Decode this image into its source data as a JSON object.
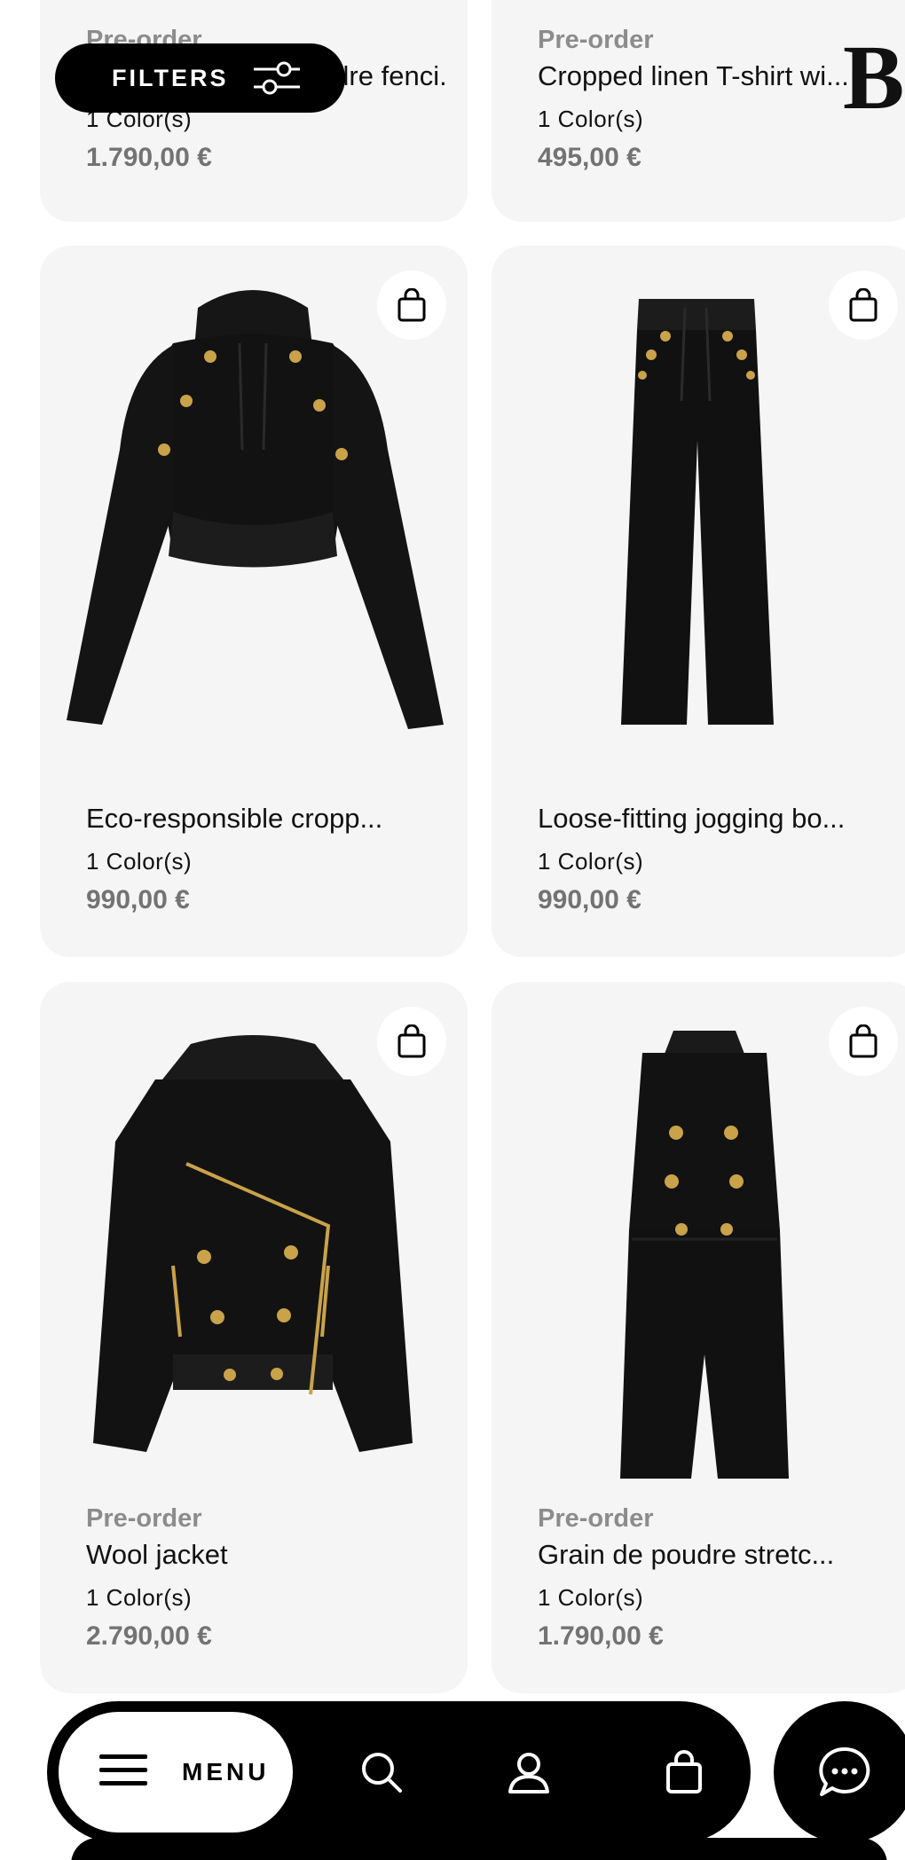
{
  "filters": {
    "label": "FILTERS"
  },
  "brand": {
    "logo_letter": "B"
  },
  "products": [
    {
      "badge": "Pre-order",
      "name": "Stretch grain de poudre fenci...",
      "colors": "1 Color(s)",
      "price": "1.790,00 €"
    },
    {
      "badge": "Pre-order",
      "name": "Cropped linen T-shirt wi...",
      "colors": "1 Color(s)",
      "price": "495,00 €"
    },
    {
      "badge": "",
      "name": "Eco-responsible cropp...",
      "colors": "1 Color(s)",
      "price": "990,00 €",
      "image": "black cropped hoodie with gold buttons"
    },
    {
      "badge": "",
      "name": "Loose-fitting jogging bo...",
      "colors": "1 Color(s)",
      "price": "990,00 €",
      "image": "black jogging pants"
    },
    {
      "badge": "Pre-order",
      "name": "Wool jacket",
      "colors": "1 Color(s)",
      "price": "2.790,00 €",
      "image": "black wool biker jacket"
    },
    {
      "badge": "Pre-order",
      "name": "Grain de poudre stretc...",
      "colors": "1 Color(s)",
      "price": "1.790,00 €",
      "image": "black sleeveless playsuit"
    }
  ],
  "nav": {
    "menu_label": "MENU",
    "icons": [
      "menu-icon",
      "search-icon",
      "account-icon",
      "bag-icon",
      "chat-icon"
    ]
  },
  "colors": {
    "card_bg": "#f5f5f5",
    "price": "#737373",
    "badge": "#8c8c8c",
    "nav_bg": "#000000",
    "gold": "#c9a24a"
  }
}
